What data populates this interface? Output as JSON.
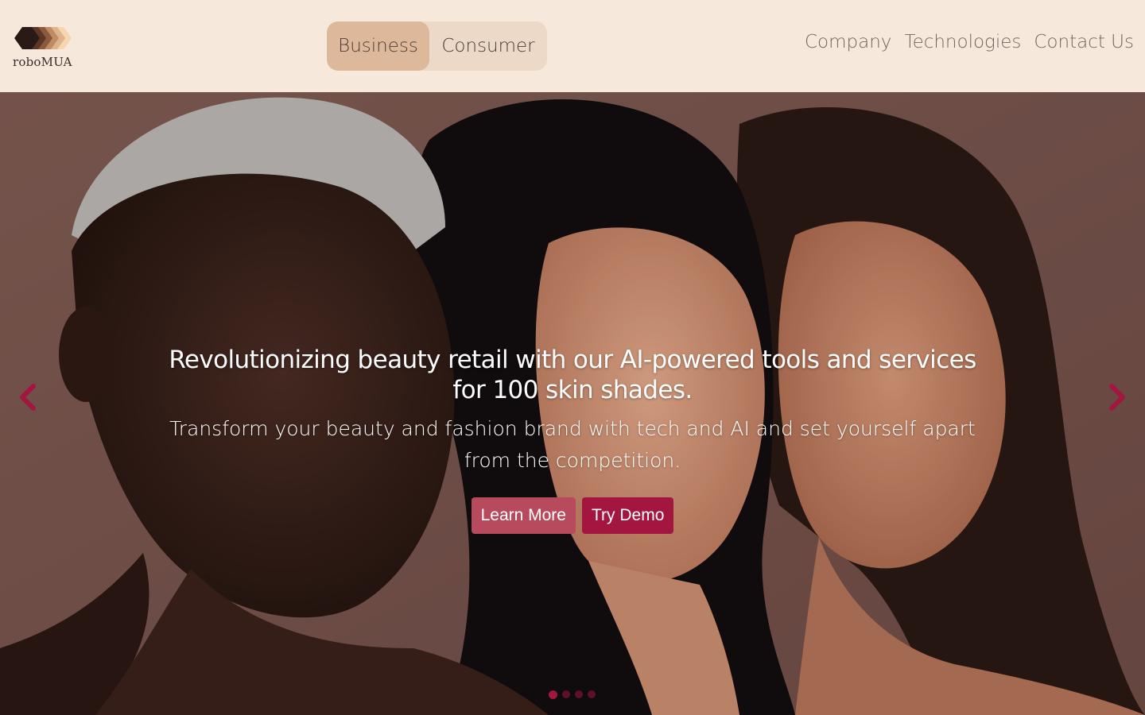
{
  "header": {
    "logo_text": "roboMUA",
    "toggle": {
      "active_label": "Business",
      "inactive_label": "Consumer"
    },
    "nav": [
      {
        "label": "Company"
      },
      {
        "label": "Technologies"
      },
      {
        "label": "Contact Us"
      }
    ]
  },
  "hero": {
    "headline": "Revolutionizing beauty retail with our AI-powered tools and services for 100 skin shades.",
    "subheadline": "Transform your beauty and fashion brand with tech and AI and set yourself apart from the competition.",
    "buttons": {
      "learn_more": "Learn More",
      "try_demo": "Try Demo"
    },
    "carousel": {
      "slide_count": 4,
      "active_slide": 1
    }
  },
  "colors": {
    "background": "#f6e9db",
    "toggle_active": "#deb89b",
    "toggle_bg": "#ecd9c8",
    "accent": "#a3163f",
    "accent_soft": "#b84a5e",
    "hero_bg": "#7c5a52"
  },
  "icons": {
    "logo": "skin-tone-swatches-icon",
    "prev": "chevron-left-icon",
    "next": "chevron-right-icon"
  }
}
